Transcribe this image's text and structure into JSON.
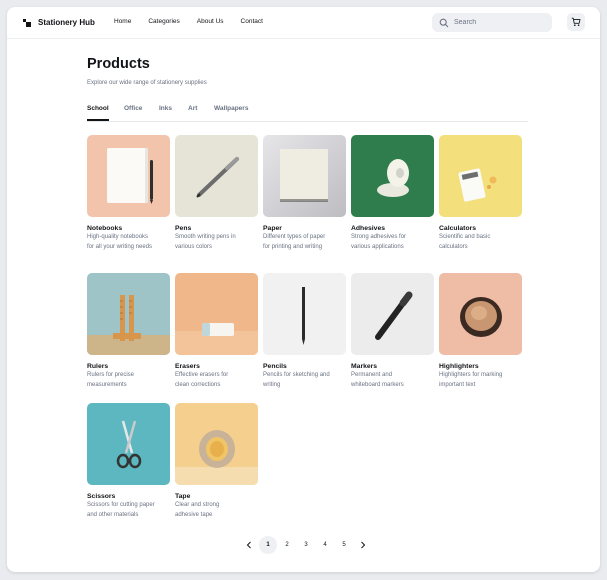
{
  "brand": {
    "name": "Stationery Hub"
  },
  "nav": {
    "items": [
      "Home",
      "Categories",
      "About Us",
      "Contact"
    ]
  },
  "search": {
    "placeholder": "Search"
  },
  "header": {
    "title": "Products",
    "subtitle": "Explore our wide range of stationery supplies"
  },
  "tabs": [
    "School",
    "Office",
    "Inks",
    "Art",
    "Wallpapers"
  ],
  "active_tab": "School",
  "products": [
    {
      "title": "Notebooks",
      "desc": "High-quality notebooks\nfor all your writing needs",
      "bg": "#f2c4ac"
    },
    {
      "title": "Pens",
      "desc": "Smooth writing pens in\nvarious colors",
      "bg": "#e6e4d7"
    },
    {
      "title": "Paper",
      "desc": "Different types of paper\nfor printing and writing",
      "bg": "#d2d2d5"
    },
    {
      "title": "Adhesives",
      "desc": "Strong adhesives for\nvarious applications",
      "bg": "#2f7d4c"
    },
    {
      "title": "Calculators",
      "desc": "Scientific and basic\ncalculators",
      "bg": "#f3df7b"
    },
    {
      "title": "Rulers",
      "desc": "Rulers for precise\nmeasurements",
      "bg": "#9ec4c8"
    },
    {
      "title": "Erasers",
      "desc": "Effective erasers for\nclean corrections",
      "bg": "#f0b88a"
    },
    {
      "title": "Pencils",
      "desc": "Pencils for sketching and\nwriting",
      "bg": "#f1f1f1"
    },
    {
      "title": "Markers",
      "desc": "Permanent and\nwhiteboard markers",
      "bg": "#ececec"
    },
    {
      "title": "Highlighters",
      "desc": "Highlighters for marking\nimportant text",
      "bg": "#efbda6"
    },
    {
      "title": "Scissors",
      "desc": "Scissors for cutting paper\nand other materials",
      "bg": "#5cb7c0"
    },
    {
      "title": "Tape",
      "desc": "Clear and strong\nadhesive tape",
      "bg": "#f4cf8d"
    }
  ],
  "pagination": {
    "pages": [
      "1",
      "2",
      "3",
      "4",
      "5"
    ],
    "current": "1",
    "prev_icon": "chevron-left-icon",
    "next_icon": "chevron-right-icon"
  },
  "icons": {
    "search": "search-icon",
    "cart": "cart-icon",
    "logo": "logo-icon"
  }
}
